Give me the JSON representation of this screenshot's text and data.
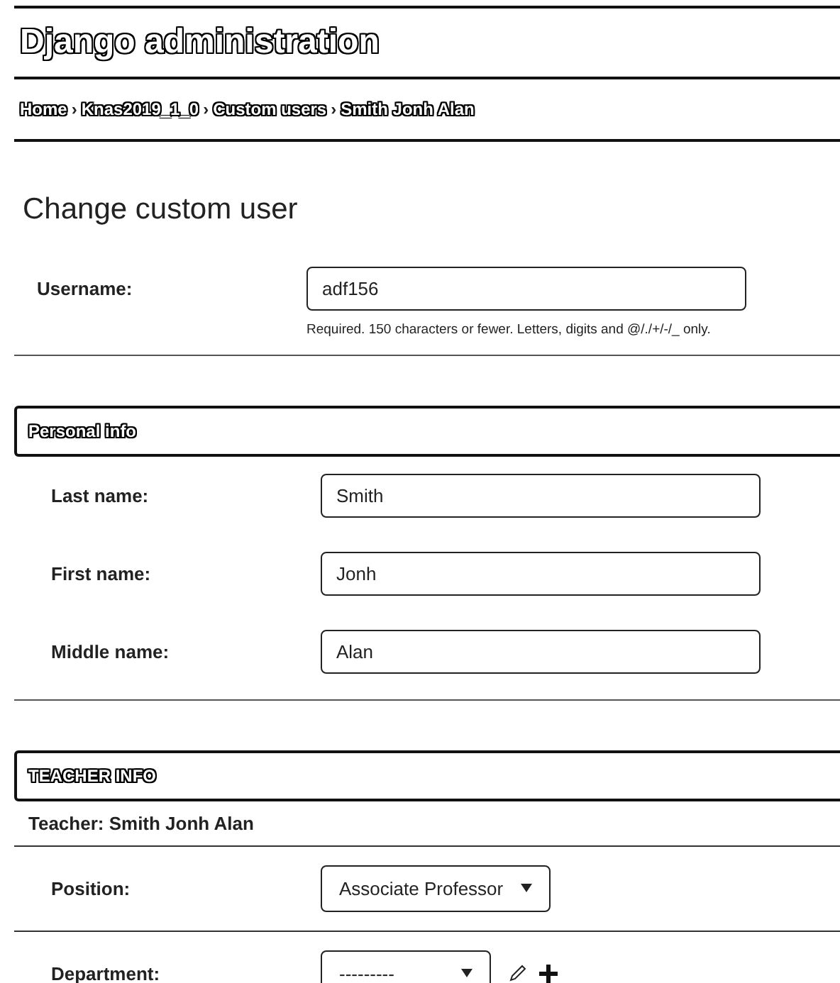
{
  "header": {
    "title": "Django administration"
  },
  "breadcrumbs": [
    "Home",
    "Knas2019_1_0",
    "Custom users",
    "Smith Jonh Alan"
  ],
  "breadcrumb_separator": "›",
  "page_title": "Change custom user",
  "username": {
    "label": "Username:",
    "value": "adf156",
    "help": "Required. 150 characters or fewer. Letters, digits and @/./+/-/_ only."
  },
  "sections": [
    {
      "title": "Personal info",
      "fields": [
        {
          "kind": "text",
          "label": "Last name:",
          "value": "Smith"
        },
        {
          "kind": "text",
          "label": "First name:",
          "value": "Jonh"
        },
        {
          "kind": "text",
          "label": "Middle name:",
          "value": "Alan"
        }
      ]
    },
    {
      "title": "TEACHER INFO",
      "inline_title": "Teacher: Smith Jonh Alan",
      "fields": [
        {
          "kind": "select",
          "label": "Position:",
          "value": "Associate Professor",
          "related_actions": false
        },
        {
          "kind": "select",
          "label": "Department:",
          "value": "---------",
          "related_actions": true
        }
      ]
    }
  ]
}
